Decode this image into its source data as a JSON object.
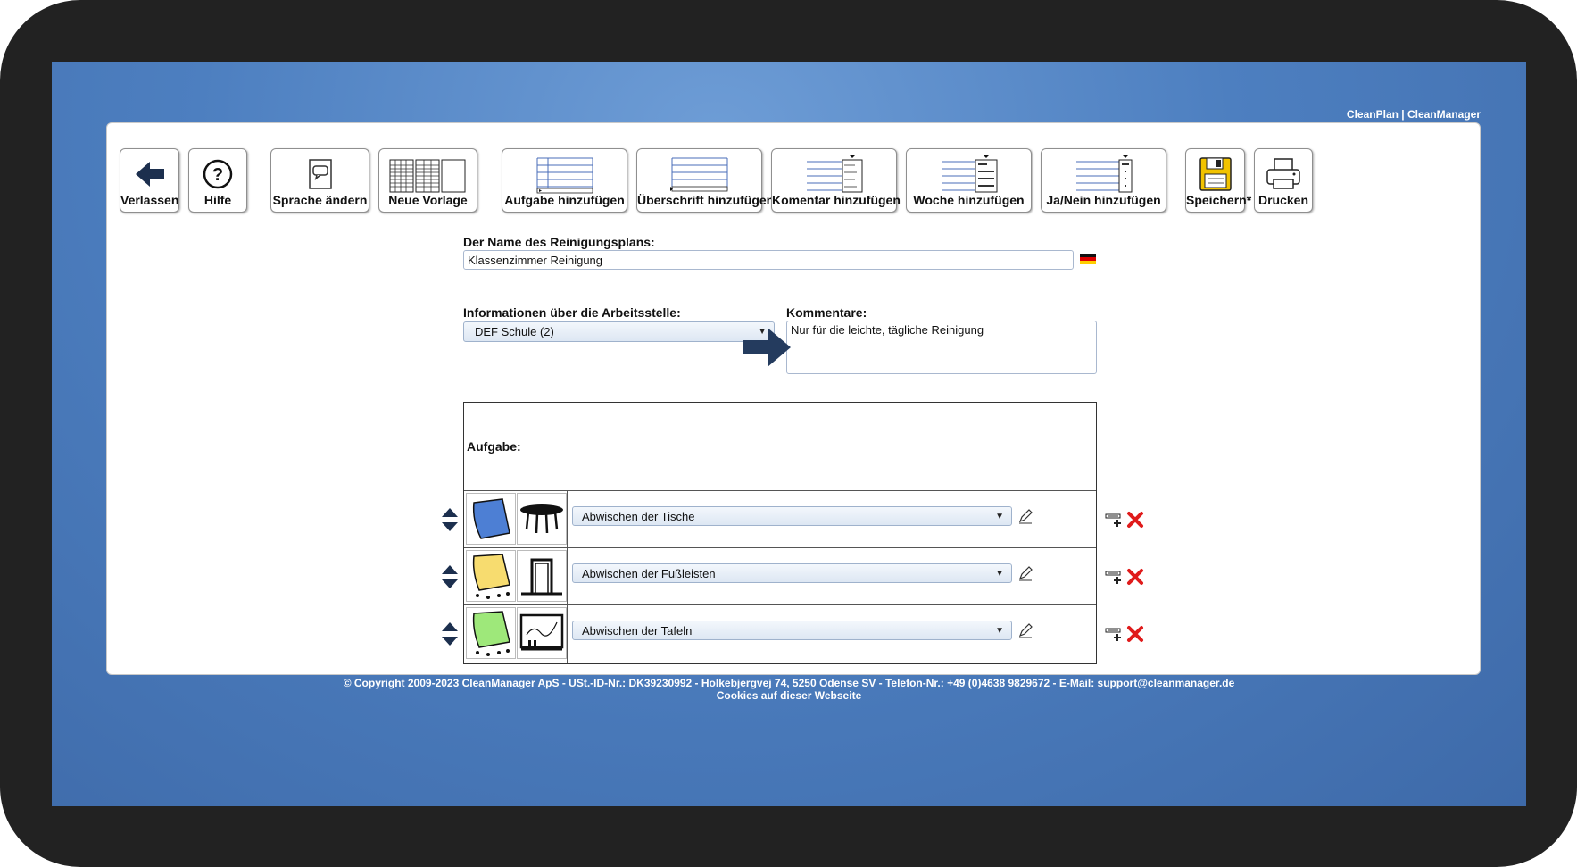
{
  "brand": "CleanPlan | CleanManager",
  "toolbar": {
    "exit": "Verlassen",
    "help": "Hilfe",
    "language": "Sprache ändern",
    "new_template": "Neue Vorlage",
    "add_task": "Aufgabe hinzufügen",
    "add_heading": "Überschrift hinzufügen",
    "add_comment": "Komentar hinzufügen",
    "add_week": "Woche hinzufügen",
    "add_yesno": "Ja/Nein hinzufügen",
    "save": "Speichern*",
    "print": "Drucken"
  },
  "form": {
    "plan_name_label": "Der Name des Reinigungsplans:",
    "plan_name_value": "Klassenzimmer Reinigung",
    "workplace_label": "Informationen über die Arbeitsstelle:",
    "workplace_value": "DEF Schule (2)",
    "comments_label": "Kommentare:",
    "comments_value": "Nur für die leichte, tägliche Reinigung"
  },
  "tasks": {
    "header": "Aufgabe:",
    "rows": [
      {
        "label": "Abwischen der Tische",
        "cloth_color": "#4d7fd4",
        "object": "table"
      },
      {
        "label": "Abwischen der Fußleisten",
        "cloth_color": "#f7dc6f",
        "object": "door"
      },
      {
        "label": "Abwischen der Tafeln",
        "cloth_color": "#9ee87a",
        "object": "board"
      }
    ]
  },
  "footer": {
    "copyright": "© Copyright 2009-2023 CleanManager ApS - USt.-ID-Nr.: DK39230992 - Holkebjergvej 74, 5250 Odense SV - Telefon-Nr.: +49 (0)4638 9829672 - E-Mail: support@cleanmanager.de",
    "cookies": "Cookies auf dieser Webseite"
  }
}
